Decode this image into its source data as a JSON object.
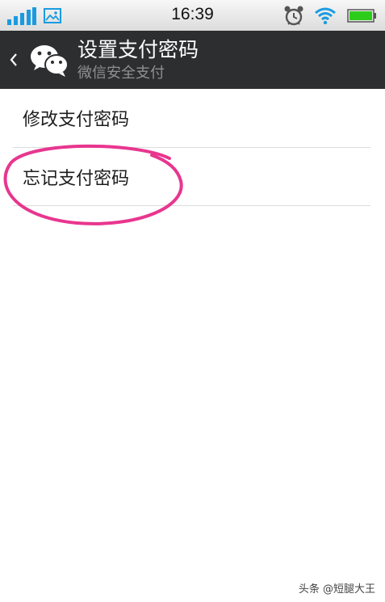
{
  "status_bar": {
    "time": "16:39",
    "icons": [
      "signal-icon",
      "gallery-icon",
      "alarm-icon",
      "wifi-icon",
      "battery-icon"
    ],
    "accent_color": "#1a9be0",
    "battery_color": "#2ecc1a"
  },
  "header": {
    "title": "设置支付密码",
    "subtitle": "微信安全支付",
    "back_icon": "chevron-left-icon",
    "logo_icon": "wechat-logo-icon",
    "background": "#2c2e2f"
  },
  "menu": {
    "items": [
      {
        "label": "修改支付密码"
      },
      {
        "label": "忘记支付密码"
      }
    ]
  },
  "annotation": {
    "highlight_color": "#e8368f",
    "highlighted_item": "忘记支付密码"
  },
  "watermark": "头条 @短腿大王"
}
